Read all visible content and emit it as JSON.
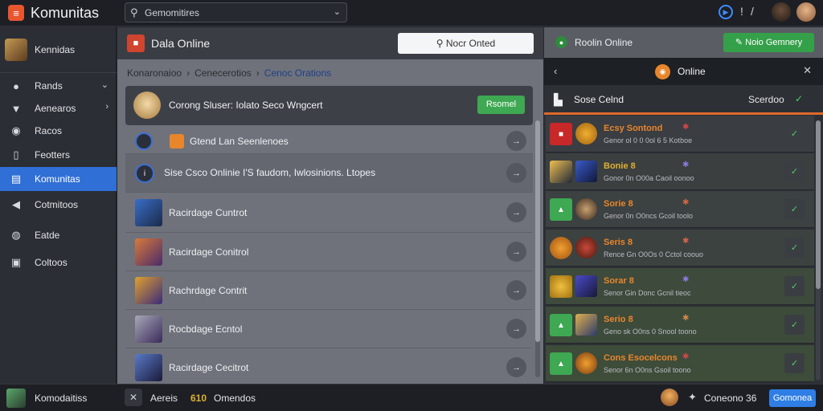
{
  "app": {
    "title": "Komunitas",
    "logo_icon": "app-logo-icon",
    "accent": "#2f6fd6"
  },
  "search": {
    "value": "Gemomitires"
  },
  "sidebar": {
    "profile_label": "Kennidas",
    "items": [
      {
        "label": "Rands",
        "icon": "person-icon",
        "chevron": "⌄"
      },
      {
        "label": "Aenearos",
        "icon": "shield-icon",
        "chevron": "›"
      },
      {
        "label": "Racos",
        "icon": "coin-icon"
      },
      {
        "label": "Feotters",
        "icon": "card-icon"
      },
      {
        "label": "Komunitas",
        "icon": "list-icon",
        "active": true
      },
      {
        "label": "Cotmitoos",
        "icon": "megaphone-icon"
      },
      {
        "label": "Eatde",
        "icon": "globe-icon"
      },
      {
        "label": "Coltoos",
        "icon": "chat-icon"
      }
    ]
  },
  "main": {
    "title": "Dala Online",
    "header_button": "Nocr Onted",
    "breadcrumb": {
      "first": "Konaronaioo",
      "second": "Cenecerotios",
      "current": "Cenoc Orations"
    },
    "feature": {
      "text": "Corong Sluser: Iolato Seco Wngcert",
      "button": "Rsomel"
    },
    "rows": [
      {
        "text": "Gtend Lan Seenlenoes"
      },
      {
        "text": "Sise Csco Onlinie I'S faudom, Iwlosinions. Ltopes"
      },
      {
        "text": "Racirdage Cuntrot"
      },
      {
        "text": "Racirdage Conitrol"
      },
      {
        "text": "Rachrdage Contrit"
      },
      {
        "text": "Rocbdage Ecntol"
      },
      {
        "text": "Racirdage Cecitrot"
      }
    ]
  },
  "right_panel": {
    "header_title": "Roolin Online",
    "header_button": "Noio Gemnery",
    "nav_title": "Online",
    "subheader": {
      "title": "Sose Celnd",
      "status": "Scerdoo"
    },
    "cards": [
      {
        "title": "Ecsy Sontond",
        "subtitle": "Genor ol 0 0 0ol 6 5 Kotboe",
        "title_color": "#e8862c",
        "tint": "#3a3d42"
      },
      {
        "title": "Bonie 8",
        "subtitle": "Gonor 0n O00a Caoil oonoo",
        "title_color": "#e0b030",
        "tint": "#3b3f40"
      },
      {
        "title": "Sorie 8",
        "subtitle": "Genor 0n O0ncs Gcoil toolo",
        "title_color": "#e8862c",
        "tint": "#3c4141"
      },
      {
        "title": "Seris 8",
        "subtitle": "Rence Gn O0Os 0 Cctol coouo",
        "title_color": "#e8862c",
        "tint": "#3c4240"
      },
      {
        "title": "Sorar 8",
        "subtitle": "Senor Gin Donc Gcnil tieoc",
        "title_color": "#e8862c",
        "tint": "#3d4a3c"
      },
      {
        "title": "Serio 8",
        "subtitle": "Geno sk O0ns 0 Snool toono",
        "title_color": "#e8862c",
        "tint": "#3d4b3b"
      },
      {
        "title": "Cons Esocelcons",
        "subtitle": "Senor 6n O0ns Gsoil toono",
        "title_color": "#e8862c",
        "tint": "#3e4c3a"
      }
    ]
  },
  "footer": {
    "user": "Komodaitiss",
    "grade_label": "Aereis",
    "grade_value": "610",
    "status": "Omendos",
    "count": "Coneono 36",
    "button": "Gomonea"
  }
}
